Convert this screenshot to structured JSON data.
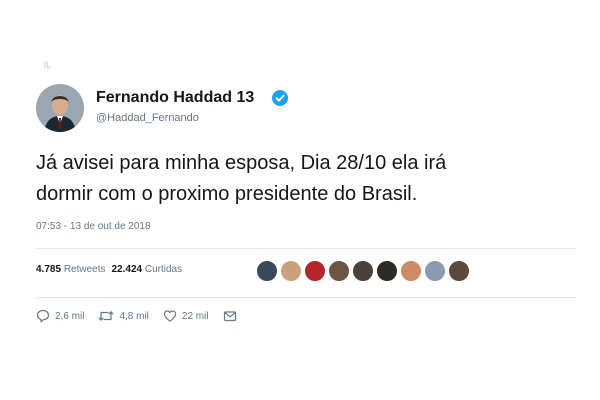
{
  "corner_mark": "lL",
  "author": {
    "display_name": "Fernando Haddad 13",
    "handle": "@Haddad_Fernando",
    "verified": true
  },
  "tweet": {
    "text": "Já avisei para minha esposa, Dia 28/10 ela irá\ndormir com o proximo presidente do Brasil.",
    "timestamp": "07:53 - 13 de out de 2018"
  },
  "stats": {
    "retweets_count": "4.785",
    "retweets_label": "Retweets",
    "likes_count": "22.424",
    "likes_label": "Curtidas"
  },
  "likers": [
    {
      "color": "#3a4a5a"
    },
    {
      "color": "#c9a27a"
    },
    {
      "color": "#b3262d"
    },
    {
      "color": "#6b5444"
    },
    {
      "color": "#4a4038"
    },
    {
      "color": "#2e2a28"
    },
    {
      "color": "#d08a66"
    },
    {
      "color": "#8a9bb0"
    },
    {
      "color": "#5a4a3e"
    }
  ],
  "actions": {
    "reply_count": "2,6 mil",
    "retweet_count": "4,8 mil",
    "like_count": "22 mil"
  },
  "colors": {
    "verified_blue": "#1da1f2",
    "secondary_text": "#657786"
  }
}
